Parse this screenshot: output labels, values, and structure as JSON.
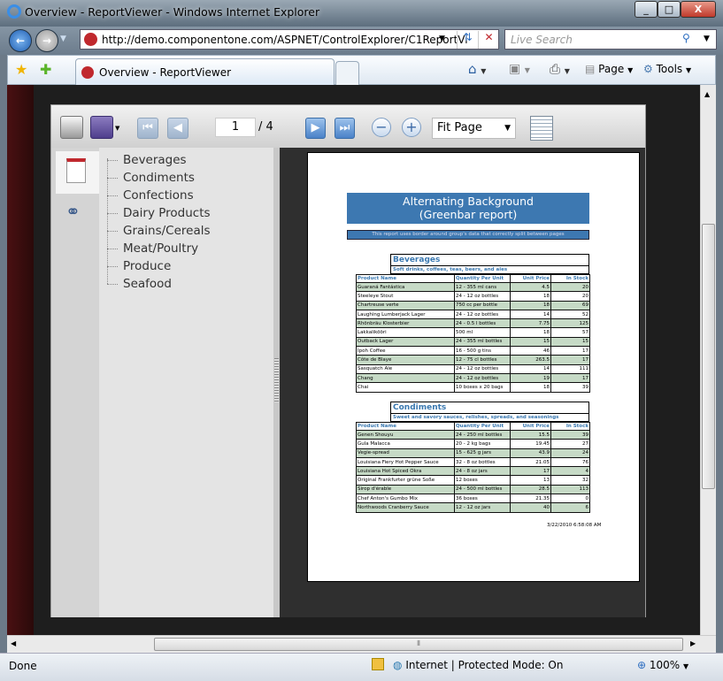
{
  "window": {
    "title": "Overview - ReportViewer - Windows Internet Explorer"
  },
  "address": {
    "url": "http://demo.componentone.com/ASPNET/ControlExplorer/C1ReportVi",
    "search_placeholder": "Live Search"
  },
  "tab": {
    "label": "Overview - ReportViewer"
  },
  "commands": {
    "page": "Page",
    "tools": "Tools"
  },
  "toolbar": {
    "page_number": "1",
    "page_total": "/ 4",
    "zoom": "Fit Page"
  },
  "outline": [
    "Beverages",
    "Condiments",
    "Confections",
    "Dairy Products",
    "Grains/Cereals",
    "Meat/Poultry",
    "Produce",
    "Seafood"
  ],
  "report": {
    "title_line1": "Alternating Background",
    "title_line2": "(Greenbar report)",
    "subtitle": "This report uses border around group's data that correctly split between pages",
    "columns": [
      "Product Name",
      "Quantity Per Unit",
      "Unit Price",
      "In Stock"
    ],
    "groups": [
      {
        "name": "Beverages",
        "description": "Soft drinks, coffees, teas, beers, and ales",
        "rows": [
          [
            "Guaraná Fantástica",
            "12 - 355 ml cans",
            "4.5",
            "20"
          ],
          [
            "Steeleye Stout",
            "24 - 12 oz bottles",
            "18",
            "20"
          ],
          [
            "Chartreuse verte",
            "750 cc per bottle",
            "18",
            "69"
          ],
          [
            "Laughing Lumberjack Lager",
            "24 - 12 oz bottles",
            "14",
            "52"
          ],
          [
            "Rhönbräu Klosterbier",
            "24 - 0.5 l bottles",
            "7.75",
            "125"
          ],
          [
            "Lakkalikööri",
            "500 ml",
            "18",
            "57"
          ],
          [
            "Outback Lager",
            "24 - 355 ml bottles",
            "15",
            "15"
          ],
          [
            "Ipoh Coffee",
            "16 - 500 g tins",
            "46",
            "17"
          ],
          [
            "Côte de Blaye",
            "12 - 75 cl bottles",
            "263.5",
            "17"
          ],
          [
            "Sasquatch Ale",
            "24 - 12 oz bottles",
            "14",
            "111"
          ],
          [
            "Chang",
            "24 - 12 oz bottles",
            "19",
            "17"
          ],
          [
            "Chai",
            "10 boxes x 20 bags",
            "18",
            "39"
          ]
        ]
      },
      {
        "name": "Condiments",
        "description": "Sweet and savory sauces, relishes, spreads, and seasonings",
        "rows": [
          [
            "Genen Shouyu",
            "24 - 250 ml bottles",
            "15.5",
            "39"
          ],
          [
            "Gula Malacca",
            "20 - 2 kg bags",
            "19.45",
            "27"
          ],
          [
            "Vegie-spread",
            "15 - 625 g jars",
            "43.9",
            "24"
          ],
          [
            "Louisiana Fiery Hot Pepper Sauce",
            "32 - 8 oz bottles",
            "21.05",
            "76"
          ],
          [
            "Louisiana Hot Spiced Okra",
            "24 - 8 oz jars",
            "17",
            "4"
          ],
          [
            "Original Frankfurter grüne Soße",
            "12 boxes",
            "13",
            "32"
          ],
          [
            "Sirop d'érable",
            "24 - 500 ml bottles",
            "28.5",
            "113"
          ],
          [
            "Chef Anton's Gumbo Mix",
            "36 boxes",
            "21.35",
            "0"
          ],
          [
            "Northwoods Cranberry Sauce",
            "12 - 12 oz jars",
            "40",
            "6"
          ]
        ]
      }
    ],
    "timestamp": "3/22/2010 6:58:08 AM"
  },
  "status": {
    "text": "Done",
    "zone": "Internet | Protected Mode: On",
    "zoom": "100%"
  },
  "colors": {
    "report_blue": "#3d78b1",
    "greenbar": "#c6dac6"
  }
}
